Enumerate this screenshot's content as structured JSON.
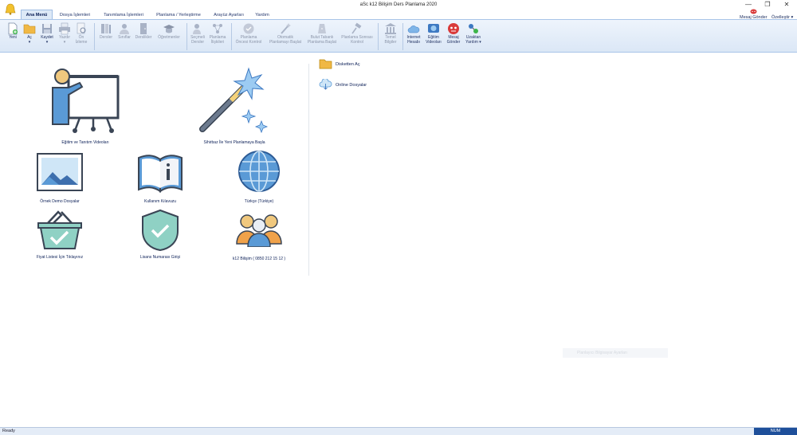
{
  "window": {
    "title": "aSc k12 Bilişim Ders Planlama 2020",
    "minimize": "—",
    "restore": "❐",
    "close": "✕"
  },
  "tabs": [
    {
      "label": "Ana Menü"
    },
    {
      "label": "Dosya İşlemleri"
    },
    {
      "label": "Tanımlama İşlemleri"
    },
    {
      "label": "Planlama / Yerleştirme"
    },
    {
      "label": "Arayüz Ayarları"
    },
    {
      "label": "Yardım"
    }
  ],
  "ribbon": {
    "yeni": "Yeni",
    "ac": "Aç",
    "kaydet": "Kaydet",
    "yazdir": "Yazdır",
    "on_izleme": "Ön\nİzleme",
    "dersler": "Dersler",
    "sniflar": "Sınıflar",
    "derslikler": "Derslikler",
    "ogretmenler": "Öğretmenler",
    "secmeli_dersler": "Seçmeli\nDersler",
    "planlama_iliskileri": "Planlama\nİlişkileri",
    "planlama_oncesi_kontrol": "Planlama\nÖncesi Kontrol",
    "otomatik_planlamayi_baslat": "Otomatik\nPlanlamayı Başlat",
    "bulut_tabanli": "Bulut Tabanlı\nPlanlama Başlat",
    "planlama_sonrasi_kontrol": "Planlama Sonrası\nKontrol",
    "temel_bilgiler": "Temel\nBilgiler",
    "internet_hesabi": "Internet\nHesabı",
    "egitim_videolari": "Eğitim\nVideoları",
    "mesaj_gonder": "Mesaj\nGönder",
    "uzaktan_yardim": "Uzaktan\nYardım ▾",
    "dropdown_marker": "▾"
  },
  "corner": {
    "mesaj_gonder": "Mesaj Gönder",
    "ozellestir": "Özelleştir ▾"
  },
  "tiles": {
    "egitim_tanitim": "Eğitim ve Tanıtım Videoları",
    "sihirbaz": "Sihirbaz İle Yeni Planlamaya Başla",
    "ornek_demo": "Örnek Demo Dosyalar",
    "kullanim_kilavuzu": "Kullanım Kılavuzu",
    "turkce": "Türkçe (Türkiye)",
    "fiyat_listesi": "Fiyat Listesi İçin Tıklayınız",
    "lisans": "Lisans Numarası Girişi",
    "k12_bilisim": "k12 Bilişim ( 0850 212 15 12 )"
  },
  "links": {
    "disketten_ac": "Disketten Aç",
    "online_dosyalar": "Online Dosyalar"
  },
  "toast": {
    "text": "Planlayıcı Bilgisayar Ayarları"
  },
  "status": {
    "left": "Ready",
    "num": "NUM"
  },
  "colors": {
    "accent": "#1e4f9a",
    "ribbon": "#dbe7f6",
    "teal_check": "#8fd1c4"
  }
}
